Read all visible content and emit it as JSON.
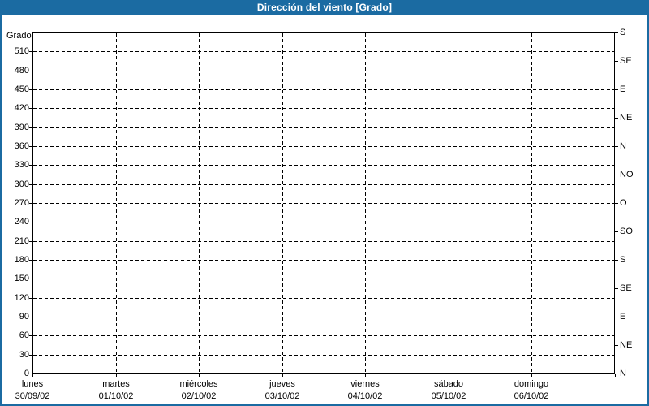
{
  "window": {
    "title": "Dirección del viento [Grado]"
  },
  "colors": {
    "titlebar_bg": "#1b6ba2",
    "titlebar_text": "#ffffff",
    "frame": "#1b6ba2",
    "grid": "#000000",
    "text": "#000000",
    "plot_bg": "#ffffff"
  },
  "chart_data": {
    "type": "line",
    "title": "Dirección del viento [Grado]",
    "ylabel": "Grado",
    "ylim": [
      0,
      540
    ],
    "y_tick_step": 30,
    "grid": "dashed",
    "legend": "none",
    "y_ticks_left": [
      0,
      30,
      60,
      90,
      120,
      150,
      180,
      210,
      240,
      270,
      300,
      330,
      360,
      390,
      420,
      450,
      480,
      510
    ],
    "y_ticks_right": [
      {
        "deg": 0,
        "label": "N"
      },
      {
        "deg": 45,
        "label": "NE"
      },
      {
        "deg": 90,
        "label": "E"
      },
      {
        "deg": 135,
        "label": "SE"
      },
      {
        "deg": 180,
        "label": "S"
      },
      {
        "deg": 225,
        "label": "SO"
      },
      {
        "deg": 270,
        "label": "O"
      },
      {
        "deg": 315,
        "label": "NO"
      },
      {
        "deg": 360,
        "label": "N"
      },
      {
        "deg": 405,
        "label": "NE"
      },
      {
        "deg": 450,
        "label": "E"
      },
      {
        "deg": 495,
        "label": "SE"
      },
      {
        "deg": 540,
        "label": "S"
      }
    ],
    "x_ticks": [
      {
        "day": "lunes",
        "date": "30/09/02"
      },
      {
        "day": "martes",
        "date": "01/10/02"
      },
      {
        "day": "miércoles",
        "date": "02/10/02"
      },
      {
        "day": "jueves",
        "date": "03/10/02"
      },
      {
        "day": "viernes",
        "date": "04/10/02"
      },
      {
        "day": "sábado",
        "date": "05/10/02"
      },
      {
        "day": "domingo",
        "date": "06/10/02"
      }
    ],
    "x_days_span": 7,
    "series": []
  }
}
